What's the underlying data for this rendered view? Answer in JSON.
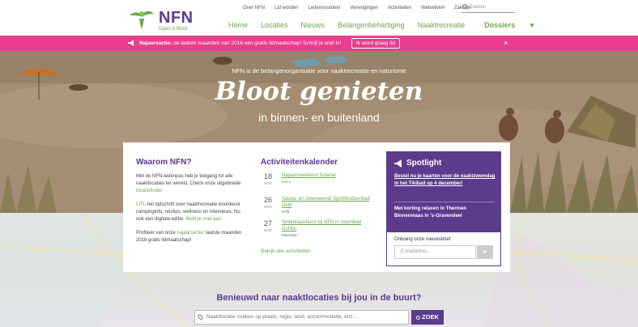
{
  "logo": {
    "name": "NFN",
    "tagline": "Open & Bloot"
  },
  "topnav": [
    "Over NFN",
    "Lid worden",
    "Ledenvoordeel",
    "Verenigingen",
    "Activiteiten",
    "Webwinkel",
    "Zakelijk"
  ],
  "top_search": {
    "placeholder": "Zoeken"
  },
  "mainnav": [
    "Home",
    "Locaties",
    "Nieuws",
    "Belangenbehartiging",
    "Naaktrecreatie",
    "Dossiers"
  ],
  "promo": {
    "label": "Najaarsactie:",
    "text": "de laatste maanden van 2016 een gratis lidmaatschap!",
    "link": "Schrijf je snel in!",
    "button": "Ik word graag lid",
    "close": "×"
  },
  "hero": {
    "subtitle": "NFN is de belangenorganisatie voor naaktrecreatie en naturisme",
    "title": "Bloot genieten",
    "title2": "in binnen- en buitenland"
  },
  "why": {
    "title": "Waarom NFN?",
    "p1": "Met de NFN-ledenpas heb je toegang tot alle naaktlocaties ter wereld. Check onze uitgebreide",
    "p1_link": "locatiefinder",
    "p2_link": "LITI",
    "p2": ", het tijdschrift over naaktrecreatie boordevol campinginfo, reistips, wellness en interviews. Nu ook een digitale editie.",
    "p2_link2": "Meld je snel aan.",
    "p3a": "Profiteer van onze",
    "p3_link": "najaarsactie",
    "p3b": ": laatste maanden 2016 gratis lidmaatschap!"
  },
  "calendar": {
    "title": "Activiteitenkalender",
    "events": [
      {
        "day": "18",
        "month": "NOV",
        "title": "Najaarsweekend Solanat",
        "place": "HALL"
      },
      {
        "day": "26",
        "month": "NOV",
        "title": "Sauna- en zwemavond Sportfondsenbad Delft",
        "place": "Delft"
      },
      {
        "day": "27",
        "month": "NOV",
        "title": "Sinterklaasfeest bij NFN in zwembad DoHijn",
        "place": "Meerssen"
      }
    ],
    "more": "Bekijk alle activiteiten"
  },
  "spotlight": {
    "title": "Spotlight",
    "item1": "Bestel nu je kaarten voor de naaktzwemdag in het Tikibad op 4 december!",
    "item2": "Met korting relaxen in Thermen Binnenmaas in 's-Gravendeel",
    "newsletter": "Ontvang onze nieuwsbrief",
    "email_placeholder": "E-mailadres..."
  },
  "locator": {
    "question": "Benieuwd naar naaktlocaties bij jou in de buurt?",
    "placeholder": "Naaktlocatie zoeken op plaats, regio, land, accommodatie, enz...",
    "button": "ZOEK"
  },
  "colors": {
    "purple": "#5a3b8c",
    "green": "#6aa84f",
    "pink": "#e83e8c"
  }
}
